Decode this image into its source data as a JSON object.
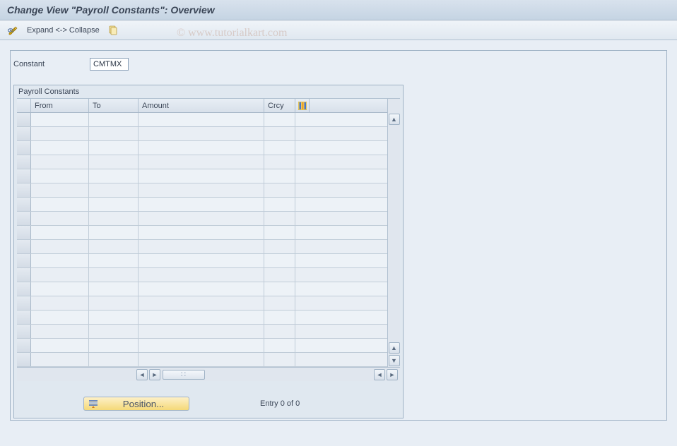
{
  "title": "Change View \"Payroll Constants\": Overview",
  "toolbar": {
    "expand_collapse_label": "Expand <-> Collapse"
  },
  "watermark": "© www.tutorialkart.com",
  "constant": {
    "label": "Constant",
    "value": "CMTMX"
  },
  "panel": {
    "title": "Payroll Constants",
    "columns": {
      "from": "From",
      "to": "To",
      "amount": "Amount",
      "crcy": "Crcy"
    },
    "rows": [
      {
        "from": "",
        "to": "",
        "amount": "",
        "crcy": ""
      },
      {
        "from": "",
        "to": "",
        "amount": "",
        "crcy": ""
      },
      {
        "from": "",
        "to": "",
        "amount": "",
        "crcy": ""
      },
      {
        "from": "",
        "to": "",
        "amount": "",
        "crcy": ""
      },
      {
        "from": "",
        "to": "",
        "amount": "",
        "crcy": ""
      },
      {
        "from": "",
        "to": "",
        "amount": "",
        "crcy": ""
      },
      {
        "from": "",
        "to": "",
        "amount": "",
        "crcy": ""
      },
      {
        "from": "",
        "to": "",
        "amount": "",
        "crcy": ""
      },
      {
        "from": "",
        "to": "",
        "amount": "",
        "crcy": ""
      },
      {
        "from": "",
        "to": "",
        "amount": "",
        "crcy": ""
      },
      {
        "from": "",
        "to": "",
        "amount": "",
        "crcy": ""
      },
      {
        "from": "",
        "to": "",
        "amount": "",
        "crcy": ""
      },
      {
        "from": "",
        "to": "",
        "amount": "",
        "crcy": ""
      },
      {
        "from": "",
        "to": "",
        "amount": "",
        "crcy": ""
      },
      {
        "from": "",
        "to": "",
        "amount": "",
        "crcy": ""
      },
      {
        "from": "",
        "to": "",
        "amount": "",
        "crcy": ""
      },
      {
        "from": "",
        "to": "",
        "amount": "",
        "crcy": ""
      },
      {
        "from": "",
        "to": "",
        "amount": "",
        "crcy": ""
      }
    ]
  },
  "footer": {
    "position_label": "Position...",
    "entry_info": "Entry 0 of 0"
  }
}
